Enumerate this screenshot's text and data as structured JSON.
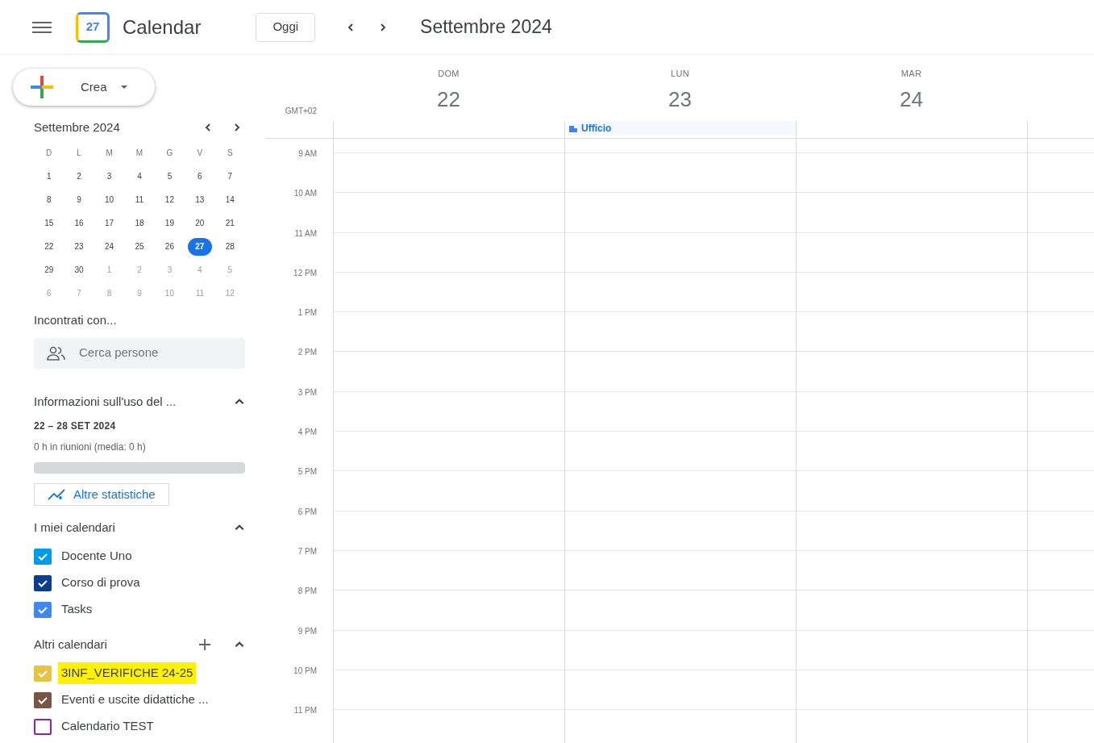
{
  "app": {
    "title": "Calendar",
    "logo_text": "27"
  },
  "toolbar": {
    "today": "Oggi",
    "period": "Settembre 2024"
  },
  "create": {
    "label": "Crea"
  },
  "mini_calendar": {
    "title": "Settembre 2024",
    "weekdays": [
      "D",
      "L",
      "M",
      "M",
      "G",
      "V",
      "S"
    ],
    "weeks": [
      [
        {
          "d": "1",
          "out": false,
          "selected": false
        },
        {
          "d": "2",
          "out": false,
          "selected": false
        },
        {
          "d": "3",
          "out": false,
          "selected": false
        },
        {
          "d": "4",
          "out": false,
          "selected": false
        },
        {
          "d": "5",
          "out": false,
          "selected": false
        },
        {
          "d": "6",
          "out": false,
          "selected": false
        },
        {
          "d": "7",
          "out": false,
          "selected": false
        }
      ],
      [
        {
          "d": "8",
          "out": false,
          "selected": false
        },
        {
          "d": "9",
          "out": false,
          "selected": false
        },
        {
          "d": "10",
          "out": false,
          "selected": false
        },
        {
          "d": "11",
          "out": false,
          "selected": false
        },
        {
          "d": "12",
          "out": false,
          "selected": false
        },
        {
          "d": "13",
          "out": false,
          "selected": false
        },
        {
          "d": "14",
          "out": false,
          "selected": false
        }
      ],
      [
        {
          "d": "15",
          "out": false,
          "selected": false
        },
        {
          "d": "16",
          "out": false,
          "selected": false
        },
        {
          "d": "17",
          "out": false,
          "selected": false
        },
        {
          "d": "18",
          "out": false,
          "selected": false
        },
        {
          "d": "19",
          "out": false,
          "selected": false
        },
        {
          "d": "20",
          "out": false,
          "selected": false
        },
        {
          "d": "21",
          "out": false,
          "selected": false
        }
      ],
      [
        {
          "d": "22",
          "out": false,
          "selected": false
        },
        {
          "d": "23",
          "out": false,
          "selected": false
        },
        {
          "d": "24",
          "out": false,
          "selected": false
        },
        {
          "d": "25",
          "out": false,
          "selected": false
        },
        {
          "d": "26",
          "out": false,
          "selected": false
        },
        {
          "d": "27",
          "out": false,
          "selected": true
        },
        {
          "d": "28",
          "out": false,
          "selected": false
        }
      ],
      [
        {
          "d": "29",
          "out": false,
          "selected": false
        },
        {
          "d": "30",
          "out": false,
          "selected": false
        },
        {
          "d": "1",
          "out": true,
          "selected": false
        },
        {
          "d": "2",
          "out": true,
          "selected": false
        },
        {
          "d": "3",
          "out": true,
          "selected": false
        },
        {
          "d": "4",
          "out": true,
          "selected": false
        },
        {
          "d": "5",
          "out": true,
          "selected": false
        }
      ],
      [
        {
          "d": "6",
          "out": true,
          "selected": false
        },
        {
          "d": "7",
          "out": true,
          "selected": false
        },
        {
          "d": "8",
          "out": true,
          "selected": false
        },
        {
          "d": "9",
          "out": true,
          "selected": false
        },
        {
          "d": "10",
          "out": true,
          "selected": false
        },
        {
          "d": "11",
          "out": true,
          "selected": false
        },
        {
          "d": "12",
          "out": true,
          "selected": false
        }
      ]
    ]
  },
  "meet": {
    "title": "Incontrati con...",
    "placeholder": "Cerca persone"
  },
  "usage": {
    "title": "Informazioni sull'uso del ...",
    "expanded": true,
    "range": "22 – 28 SET 2024",
    "summary": "0 h in riunioni (media: 0 h)",
    "button": "Altre statistiche"
  },
  "my_calendars": {
    "title": "I miei calendari",
    "expanded": true,
    "items": [
      {
        "name": "Docente Uno",
        "checked": true,
        "color": "#039be5",
        "highlighted": false
      },
      {
        "name": "Corso di prova",
        "checked": true,
        "color": "#0b3d91",
        "highlighted": false
      },
      {
        "name": "Tasks",
        "checked": true,
        "color": "#4285f4",
        "highlighted": false
      }
    ]
  },
  "other_calendars": {
    "title": "Altri calendari",
    "expanded": true,
    "items": [
      {
        "name": "3INF_VERIFICHE 24-25",
        "checked": true,
        "color": "#e4c441",
        "highlighted": true
      },
      {
        "name": "Eventi e uscite didattiche ...",
        "checked": true,
        "color": "#795548",
        "highlighted": false
      },
      {
        "name": "Calendario TEST",
        "checked": false,
        "color": "#8e24aa",
        "highlighted": false
      }
    ]
  },
  "week": {
    "timezone": "GMT+02",
    "days": [
      {
        "weekday": "DOM",
        "date": "22"
      },
      {
        "weekday": "LUN",
        "date": "23",
        "all_day_events": [
          {
            "title": "Ufficio"
          }
        ]
      },
      {
        "weekday": "MAR",
        "date": "24"
      }
    ],
    "hours": [
      "9 AM",
      "10 AM",
      "11 AM",
      "12 PM",
      "1 PM",
      "2 PM",
      "3 PM",
      "4 PM",
      "5 PM",
      "6 PM",
      "7 PM",
      "8 PM",
      "9 PM",
      "10 PM",
      "11 PM"
    ]
  }
}
